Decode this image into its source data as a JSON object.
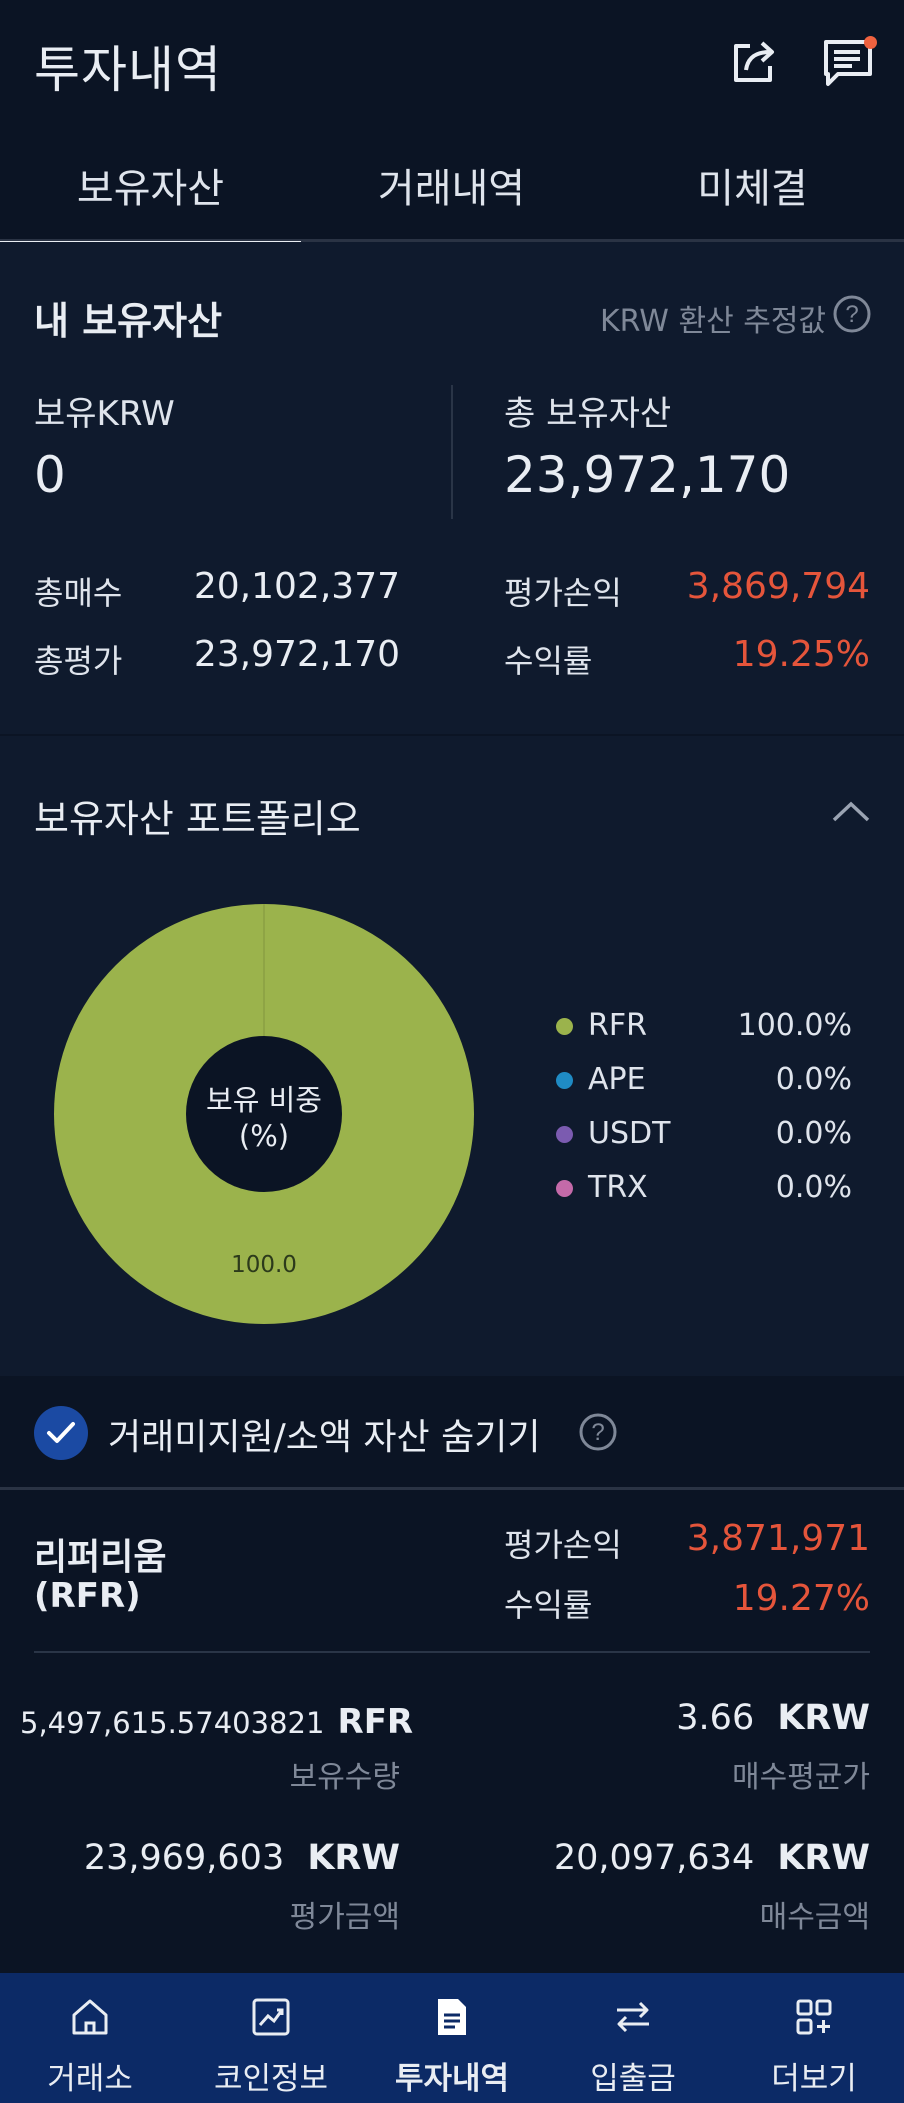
{
  "header": {
    "title": "투자내역",
    "share_icon": "share-icon",
    "notice_icon": "notice-chat-icon",
    "notice_dot_color": "#f0623f"
  },
  "tabs": [
    {
      "label": "보유자산",
      "active": true
    },
    {
      "label": "거래내역",
      "active": false
    },
    {
      "label": "미체결",
      "active": false
    }
  ],
  "my_assets": {
    "title": "내 보유자산",
    "krw_estimate_label": "KRW 환산 추정값",
    "help_icon": "question-circle-icon",
    "krw_label": "보유KRW",
    "krw_value": "0",
    "total_label": "총 보유자산",
    "total_value": "23,972,170",
    "total_buy_label": "총매수",
    "total_buy_value": "20,102,377",
    "total_eval_label": "총평가",
    "total_eval_value": "23,972,170",
    "pnl_label": "평가손익",
    "pnl_value": "3,869,794",
    "return_label": "수익률",
    "return_value": "19.25%"
  },
  "portfolio": {
    "title": "보유자산 포트폴리오",
    "collapse_icon": "chevron-up-icon",
    "center_label_1": "보유 비중",
    "center_label_2": "(%)",
    "slice_label": "100.0",
    "legend": [
      {
        "name": "RFR",
        "pct": "100.0%",
        "color": "#9bb34c"
      },
      {
        "name": "APE",
        "pct": "0.0%",
        "color": "#1f8bc4"
      },
      {
        "name": "USDT",
        "pct": "0.0%",
        "color": "#7b5bb0"
      },
      {
        "name": "TRX",
        "pct": "0.0%",
        "color": "#c46aa9"
      }
    ]
  },
  "chart_data": {
    "type": "pie",
    "categories": [
      "RFR",
      "APE",
      "USDT",
      "TRX"
    ],
    "values": [
      100.0,
      0.0,
      0.0,
      0.0
    ],
    "title": "보유 비중 (%)",
    "xlabel": "",
    "ylabel": ""
  },
  "hide_option": {
    "label": "거래미지원/소액 자산 숨기기",
    "checked": true
  },
  "holding": {
    "name": "리퍼리움",
    "symbol": "(RFR)",
    "pnl_label": "평가손익",
    "pnl_value": "3,871,971",
    "return_label": "수익률",
    "return_value": "19.27%",
    "qty_value": "5,497,615.57403821",
    "qty_unit": "RFR",
    "qty_label": "보유수량",
    "avg_value": "3.66",
    "avg_unit": "KRW",
    "avg_label": "매수평균가",
    "eval_value": "23,969,603",
    "eval_unit": "KRW",
    "eval_label": "평가금액",
    "buy_value": "20,097,634",
    "buy_unit": "KRW",
    "buy_label": "매수금액"
  },
  "bottom_nav": [
    {
      "label": "거래소",
      "icon": "home-icon",
      "active": false
    },
    {
      "label": "코인정보",
      "icon": "chart-icon",
      "active": false
    },
    {
      "label": "투자내역",
      "icon": "document-icon",
      "active": true
    },
    {
      "label": "입출금",
      "icon": "transfer-arrows-icon",
      "active": false
    },
    {
      "label": "더보기",
      "icon": "grid-plus-icon",
      "active": false
    }
  ]
}
